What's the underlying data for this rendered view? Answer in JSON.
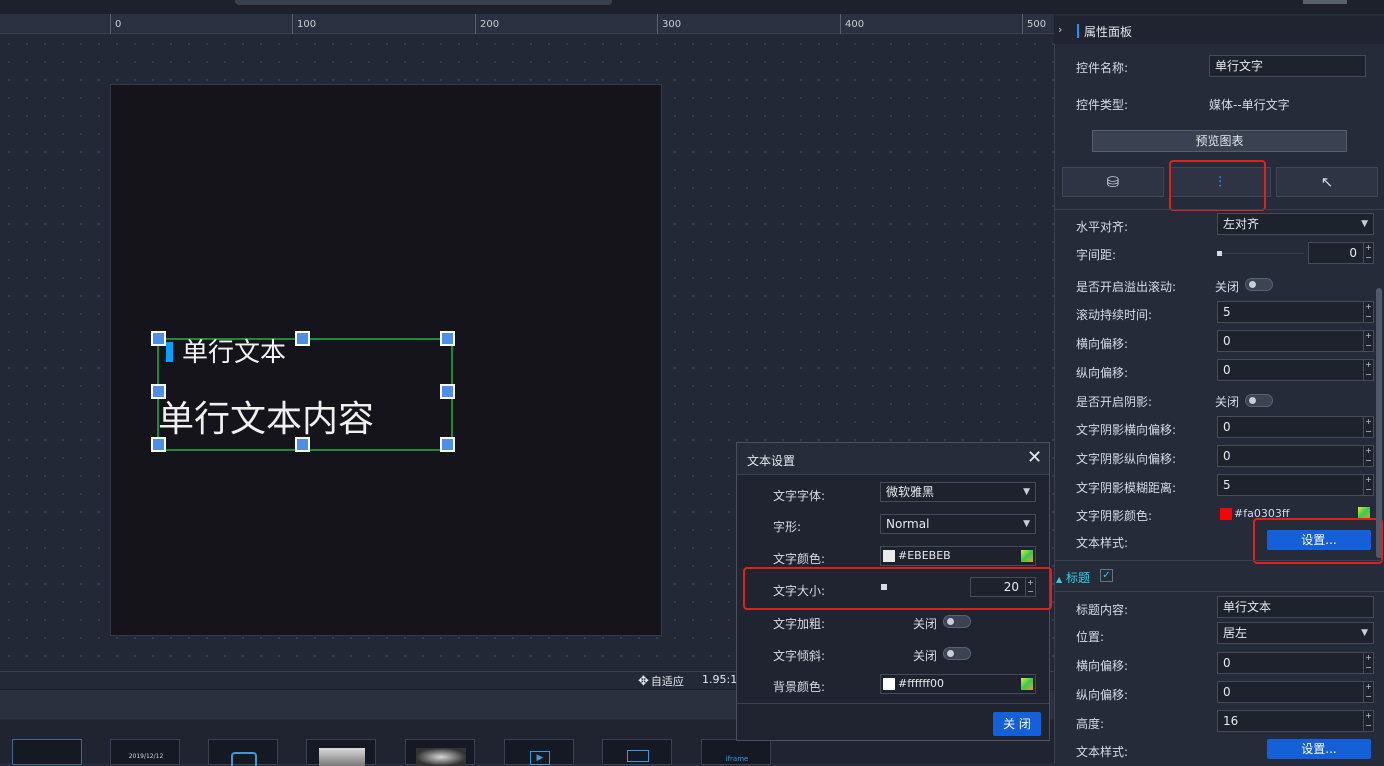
{
  "ruler": {
    "ticks": [
      "0",
      "100",
      "200",
      "300",
      "400",
      "500"
    ]
  },
  "canvas": {
    "title_text": "单行文本",
    "content_text": "单行文本内容"
  },
  "status": {
    "fit_label": "自适应",
    "ratio": "1.95:1"
  },
  "thumbs": {
    "date_label": "2019/12/12",
    "iframe_label": "iframe"
  },
  "panel": {
    "header": "属性面板",
    "name_label": "控件名称:",
    "name_value": "单行文字",
    "type_label": "控件类型:",
    "type_value": "媒体--单行文字",
    "preview_button": "预览图表",
    "rows": {
      "h_align_label": "水平对齐:",
      "h_align_value": "左对齐",
      "letter_spacing_label": "字间距:",
      "letter_spacing_value": "0",
      "overflow_scroll_label": "是否开启溢出滚动:",
      "overflow_scroll_value": "关闭",
      "scroll_duration_label": "滚动持续时间:",
      "scroll_duration_value": "5",
      "h_offset_label": "横向偏移:",
      "h_offset_value": "0",
      "v_offset_label": "纵向偏移:",
      "v_offset_value": "0",
      "shadow_label": "是否开启阴影:",
      "shadow_value": "关闭",
      "shadow_h_label": "文字阴影横向偏移:",
      "shadow_h_value": "0",
      "shadow_v_label": "文字阴影纵向偏移:",
      "shadow_v_value": "0",
      "shadow_blur_label": "文字阴影模糊距离:",
      "shadow_blur_value": "5",
      "shadow_color_label": "文字阴影颜色:",
      "shadow_color_value": "#fa0303ff",
      "text_style_label": "文本样式:",
      "text_style_button": "设置..."
    },
    "title_section": {
      "header": "标题",
      "content_label": "标题内容:",
      "content_value": "单行文本",
      "position_label": "位置:",
      "position_value": "居左",
      "h_offset_label": "横向偏移:",
      "h_offset_value": "0",
      "v_offset_label": "纵向偏移:",
      "v_offset_value": "0",
      "height_label": "高度:",
      "height_value": "16",
      "text_style_label": "文本样式:",
      "text_style_button": "设置..."
    }
  },
  "dialog": {
    "title": "文本设置",
    "font_label": "文字字体:",
    "font_value": "微软雅黑",
    "style_label": "字形:",
    "style_value": "Normal",
    "color_label": "文字颜色:",
    "color_value": "#EBEBEB",
    "size_label": "文字大小:",
    "size_value": "20",
    "bold_label": "文字加粗:",
    "bold_value": "关闭",
    "italic_label": "文字倾斜:",
    "italic_value": "关闭",
    "bg_label": "背景颜色:",
    "bg_value": "#ffffff00",
    "close_button": "关 闭"
  },
  "colors": {
    "accent": "#1560d8",
    "highlight": "#e0201c",
    "shadow_color": "#fa0303",
    "text_color": "#EBEBEB"
  },
  "icons": {
    "tab_data": "database-icon",
    "tab_style": "sliders-icon",
    "tab_interaction": "pointer-icon"
  }
}
